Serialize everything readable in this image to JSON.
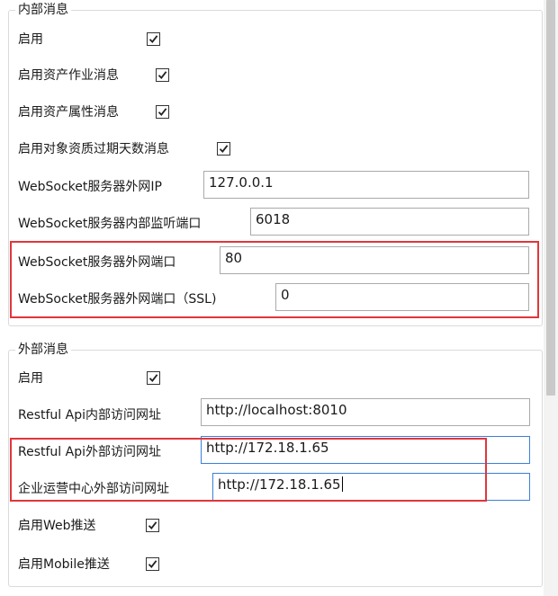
{
  "internal": {
    "legend": "内部消息",
    "enable_label": "启用",
    "enable_checked": true,
    "asset_job_label": "启用资产作业消息",
    "asset_job_checked": true,
    "asset_attr_label": "启用资产属性消息",
    "asset_attr_checked": true,
    "obj_qual_label": "启用对象资质过期天数消息",
    "obj_qual_checked": true,
    "ws_ext_ip_label": "WebSocket服务器外网IP",
    "ws_ext_ip_value": "127.0.0.1",
    "ws_int_port_label": "WebSocket服务器内部监听端口",
    "ws_int_port_value": "6018",
    "ws_ext_port_label": "WebSocket服务器外网端口",
    "ws_ext_port_value": "80",
    "ws_ext_port_ssl_label": "WebSocket服务器外网端口（SSL)",
    "ws_ext_port_ssl_value": "0"
  },
  "external": {
    "legend": "外部消息",
    "enable_label": "启用",
    "enable_checked": true,
    "restful_int_label": "Restful Api内部访问网址",
    "restful_int_value": "http://localhost:8010",
    "restful_ext_label": "Restful Api外部访问网址",
    "restful_ext_value": "http://172.18.1.65",
    "enterprise_ext_label": "企业运营中心外部访问网址",
    "enterprise_ext_value": "http://172.18.1.65",
    "web_push_label": "启用Web推送",
    "web_push_checked": true,
    "mobile_push_label": "启用Mobile推送",
    "mobile_push_checked": true
  },
  "colors": {
    "highlight": "#e0363b",
    "focus_border": "#3c7fd8"
  }
}
